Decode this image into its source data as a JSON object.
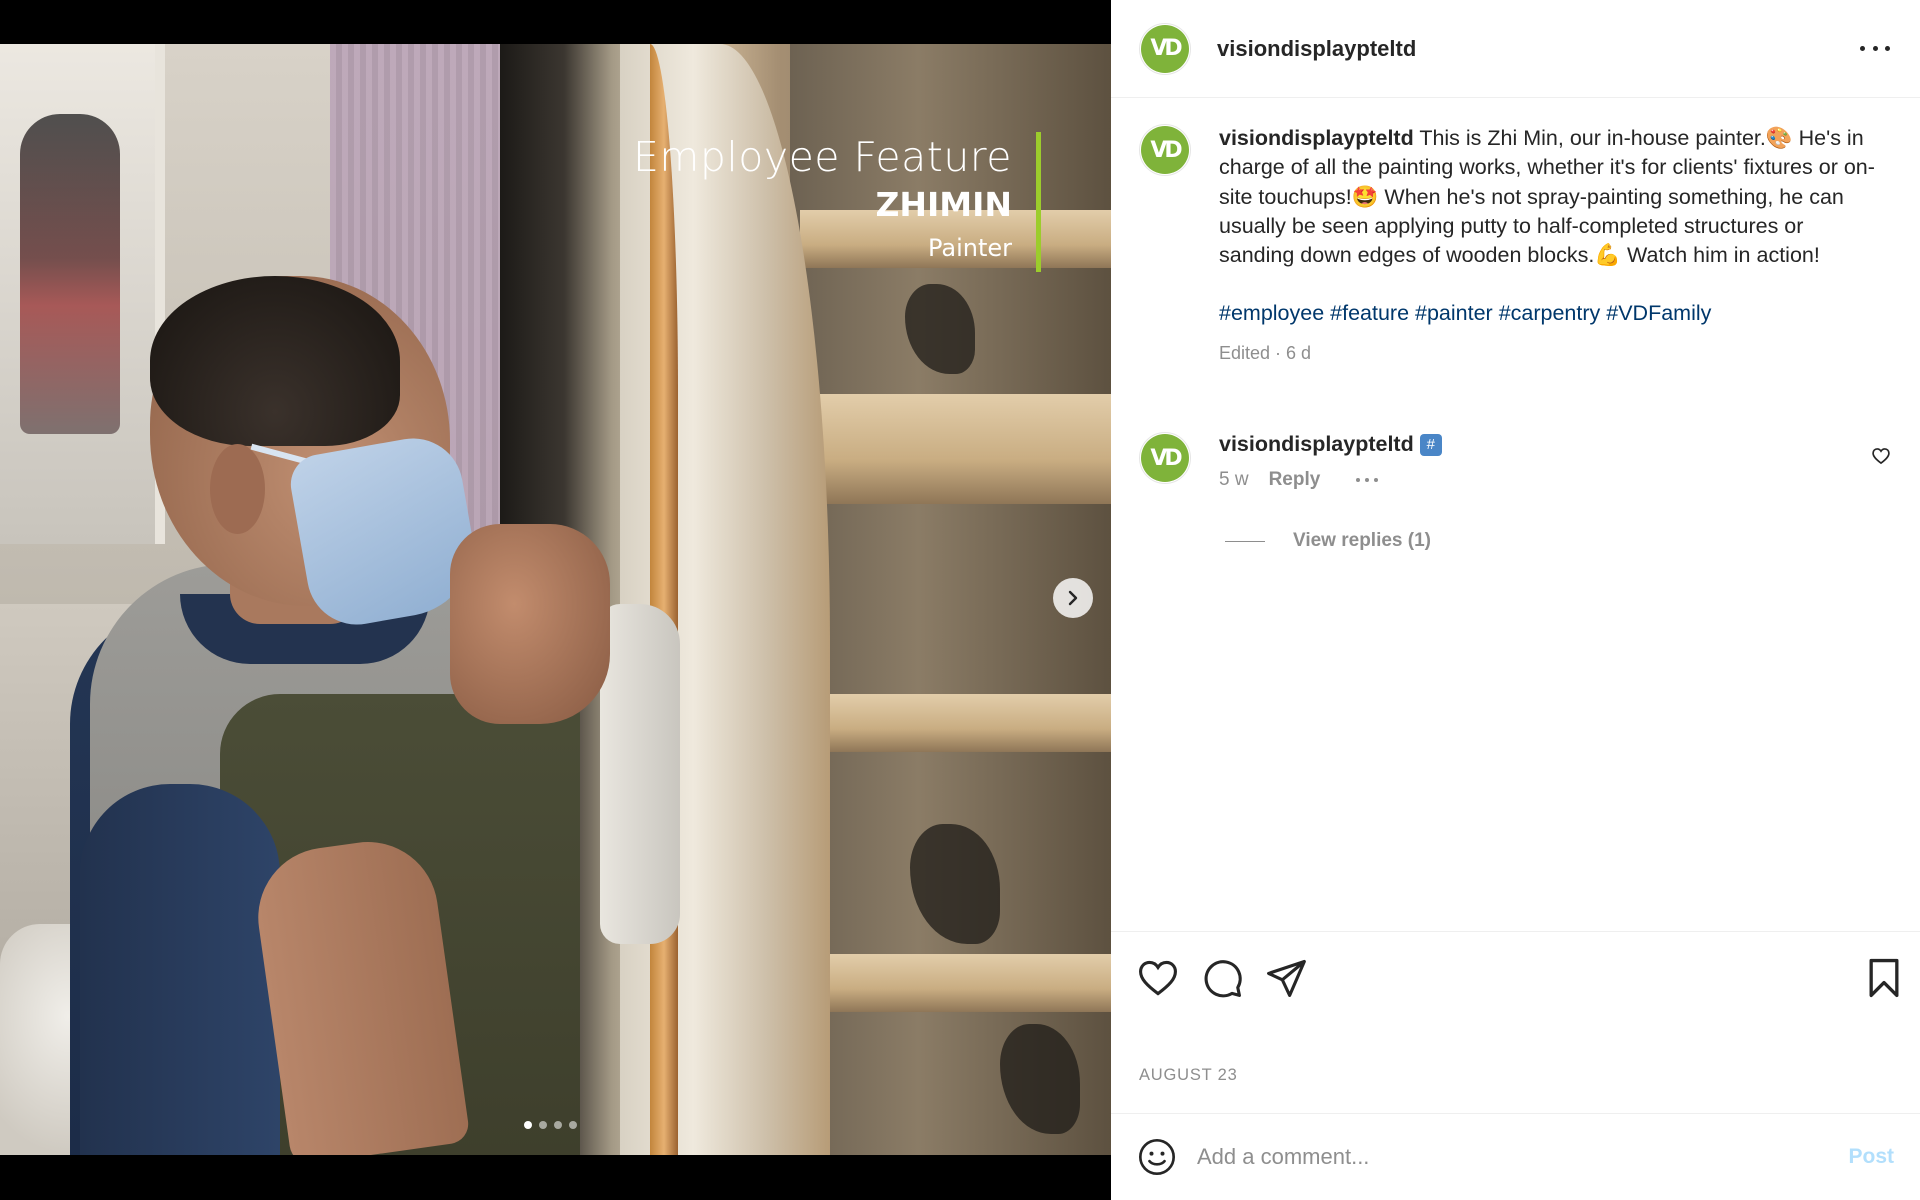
{
  "media": {
    "overlay": {
      "heading": "Employee Feature",
      "name": "ZHIMIN",
      "role": "Painter"
    },
    "carousel": {
      "total": 4,
      "current": 1
    },
    "accent_color": "#9ccc2c"
  },
  "post": {
    "username": "visiondisplaypteltd",
    "avatar_text": "VD",
    "avatar_color": "#7fb33a",
    "caption": {
      "username": "visiondisplaypteltd",
      "text": " This is Zhi Min, our in-house painter.🎨 He's in charge of all the painting works, whether it's for clients' fixtures or on-site touchups!🤩 When he's not spray-painting something, he can usually be seen applying putty to half-completed structures or sanding down edges of wooden blocks.💪 Watch him in action!",
      "hashtags": "#employee #feature #painter #carpentry #VDFamily",
      "meta": "Edited · 6 d"
    },
    "comment": {
      "username": "visiondisplaypteltd",
      "tag": "#️⃣",
      "time": "5 w",
      "reply_label": "Reply",
      "view_replies_label": "View replies (1)"
    },
    "date": "AUGUST 23",
    "comment_box": {
      "placeholder": "Add a comment...",
      "post_label": "Post"
    },
    "icons": {
      "more": "more-horizontal-icon",
      "like": "heart-icon",
      "comment": "comment-bubble-icon",
      "share": "paper-plane-icon",
      "save": "bookmark-icon",
      "emoji": "smiley-icon",
      "next": "chevron-right-icon"
    }
  }
}
